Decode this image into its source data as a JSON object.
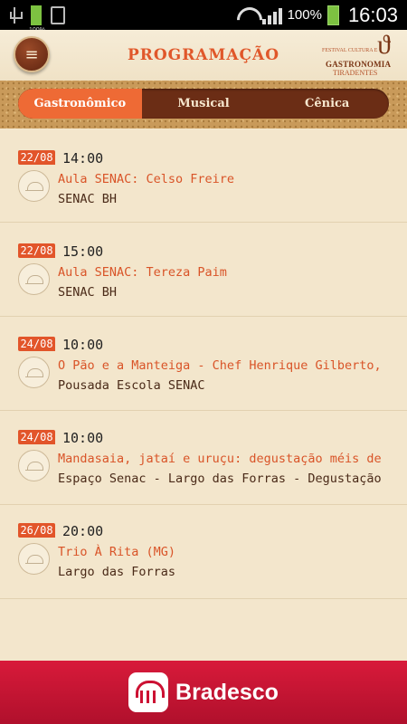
{
  "status_bar": {
    "battery_small_label": "100%",
    "battery_percent": "100%",
    "time": "16:03"
  },
  "header": {
    "menu_icon": "≡",
    "title": "PROGRAMAÇÃO",
    "logo": {
      "line1": "FESTIVAL CULTURA E",
      "line2": "GASTRONOMIA",
      "line3": "TIRADENTES"
    }
  },
  "tabs": [
    {
      "label": "Gastronômico",
      "active": true
    },
    {
      "label": "Musical",
      "active": false
    },
    {
      "label": "Cênica",
      "active": false
    }
  ],
  "events": [
    {
      "date": "22/08",
      "time": "14:00",
      "title": "Aula SENAC: Celso Freire",
      "place": "SENAC BH"
    },
    {
      "date": "22/08",
      "time": "15:00",
      "title": "Aula SENAC: Tereza Paim",
      "place": "SENAC BH"
    },
    {
      "date": "24/08",
      "time": "10:00",
      "title": "O Pão e a Manteiga - Chef Henrique Gilberto,",
      "place": "Pousada Escola SENAC"
    },
    {
      "date": "24/08",
      "time": "10:00",
      "title": "Mandasaia, jataí e uruçu: degustação méis de",
      "place": "Espaço Senac - Largo das Forras - Degustação"
    },
    {
      "date": "26/08",
      "time": "20:00",
      "title": "Trio À Rita (MG)",
      "place": "Largo das Forras"
    }
  ],
  "footer": {
    "brand": "Bradesco"
  },
  "colors": {
    "accent": "#e0572a",
    "tab_bar": "#6b2d15",
    "background": "#f3e6cc",
    "banner": "#cc1133"
  }
}
